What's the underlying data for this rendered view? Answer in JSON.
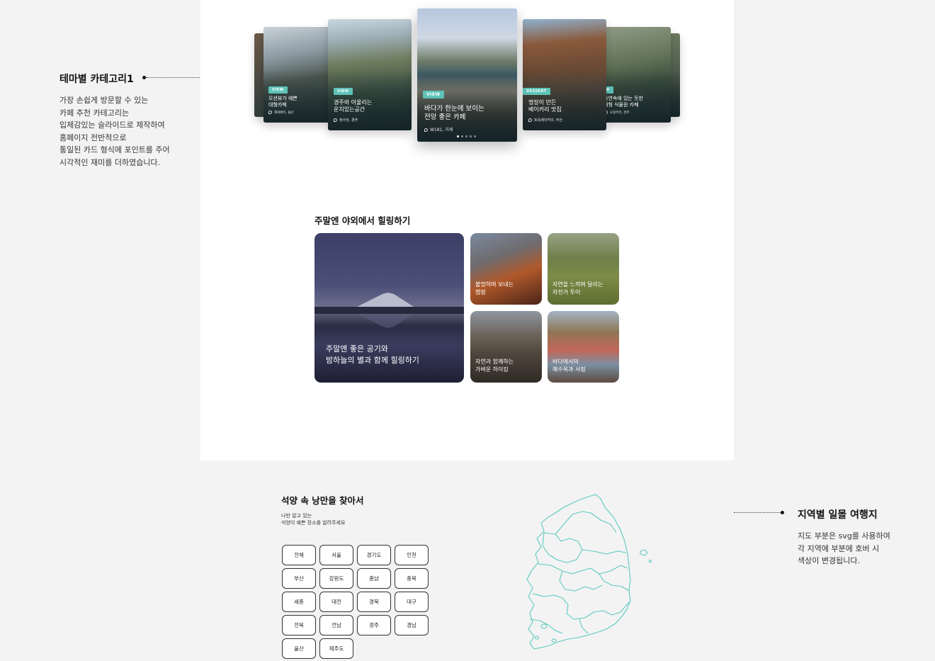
{
  "annotations": {
    "left": {
      "title": "테마별 카테고리1",
      "lines": [
        "가장 손쉽게 방문할  수 있는",
        "카페 추천 카테고리는",
        "입체감있는 슬라이드로 제작하여",
        "홈페이지 전반적으로",
        "통일된 카드 형식에 포인트를 주어",
        "시각적인 재미를 더하였습니다."
      ]
    },
    "right": {
      "title": "지역별 일몰 여행지",
      "lines": [
        "지도 부분은 svg를 사용하여",
        "각 지역에 부분에 호버 시",
        "색상이 변경됩니다."
      ]
    }
  },
  "slider": {
    "cards": [
      {
        "tag": "",
        "title_lines": [
          "",
          ""
        ],
        "location": ""
      },
      {
        "tag": "VIEW",
        "title_lines": [
          "오션뷰가 예쁜",
          "대형카페"
        ],
        "location": "해와배이, 울산"
      },
      {
        "tag": "VIEW",
        "title_lines": [
          "경주와 어울리는",
          "운치있는공간"
        ],
        "location": "청수당, 경주"
      },
      {
        "tag": "VIEW",
        "title_lines": [
          "바다가 한눈에 보이는",
          "전망 좋은 카페"
        ],
        "location": "W181, 거제"
      },
      {
        "tag": "DESSERT",
        "title_lines": [
          "명장이 만든",
          "베이커리 맛집"
        ],
        "location": "토독베이커리, 부산"
      },
      {
        "tag": "VIEW",
        "title_lines": [
          "자연속에 있는 듯한",
          "대형 식물원 카페"
        ],
        "location": "오랑주리, 경주"
      },
      {
        "tag": "",
        "title_lines": [
          "",
          ""
        ],
        "location": ""
      }
    ],
    "active_index": 3,
    "page_count": 5,
    "active_page": 1
  },
  "healing": {
    "title": "주말엔 야외에서 힐링하기",
    "main_card": {
      "lines": [
        "주말엔 좋은 공기와",
        "밤하늘의 별과 함께 힐링하기"
      ]
    },
    "cards": [
      {
        "lines": [
          "불멍하며 보내는",
          "캠핑"
        ]
      },
      {
        "lines": [
          "자연을 느끼며 달리는",
          "자전거 투어"
        ]
      },
      {
        "lines": [
          "자연과 함께하는",
          "가벼운 하이킹"
        ]
      },
      {
        "lines": [
          "바다에서의",
          "해수욕과 서핑"
        ]
      }
    ]
  },
  "sunset": {
    "title": "석양 속 낭만을 찾아서",
    "subtitle_lines": [
      "나만 알고 있는",
      "석양이 예쁜 장소를 알려주세요"
    ],
    "regions": [
      "전체",
      "서울",
      "경기도",
      "인천",
      "부산",
      "강원도",
      "충남",
      "충북",
      "세종",
      "대전",
      "경북",
      "대구",
      "전북",
      "전남",
      "광주",
      "경남",
      "울산",
      "제주도"
    ],
    "map_color": "#5ccac0"
  },
  "colors": {
    "accent": "#5fc3b8",
    "page_bg": "#f3f3f3",
    "content_bg": "#ffffff"
  }
}
